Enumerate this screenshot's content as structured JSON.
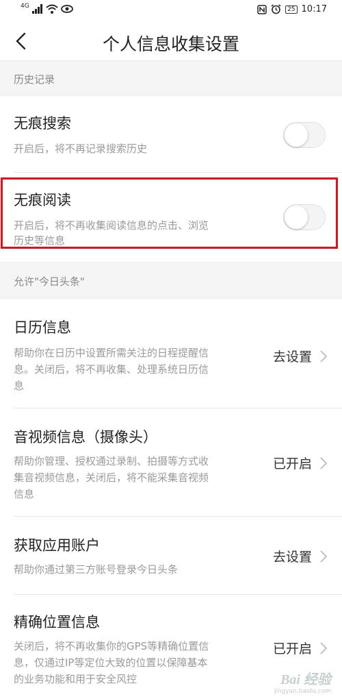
{
  "status_bar": {
    "network": "4G",
    "time": "10:17",
    "battery": "25"
  },
  "header": {
    "title": "个人信息收集设置"
  },
  "sections": {
    "history": {
      "title": "历史记录",
      "items": [
        {
          "title": "无痕搜索",
          "desc": "开启后，将不再记录搜索历史",
          "toggle_on": false
        },
        {
          "title": "无痕阅读",
          "desc_line1": "开启后，将不再收集阅读信息的点击、浏览",
          "desc_line2": "历史等信息",
          "toggle_on": false
        }
      ]
    },
    "permissions": {
      "title": "允许\"今日头条\"",
      "items": [
        {
          "title": "日历信息",
          "desc_line1": "帮助你在日历中设置所需关注的日程提醒信",
          "desc_line2": "息。关闭后，将不再收集、处理系统日历信",
          "desc_line3": "息",
          "action": "去设置"
        },
        {
          "title": "音视频信息（摄像头）",
          "desc_line1": "帮助你管理、授权通过录制、拍摄等方式收",
          "desc_line2": "集音视频信息，关闭后，将不能采集音视频",
          "desc_line3": "信息",
          "action": "已开启"
        },
        {
          "title": "获取应用账户",
          "desc": "帮助你通过第三方账号登录今日头条",
          "action": "去设置"
        },
        {
          "title": "精确位置信息",
          "desc_line1": "关闭后，将不再收集你的GPS等精确位置信",
          "desc_line2": "息，仅通过IP等定位大致的位置以保障基本",
          "desc_line3": "的业务功能和用于安全风控",
          "action": "已开启"
        }
      ]
    }
  },
  "watermark": {
    "brand": "Bai 经验",
    "url": "jingyan.baidu.com"
  },
  "colors": {
    "highlight": "#e3101a",
    "section_bg": "#f5f5f5"
  }
}
